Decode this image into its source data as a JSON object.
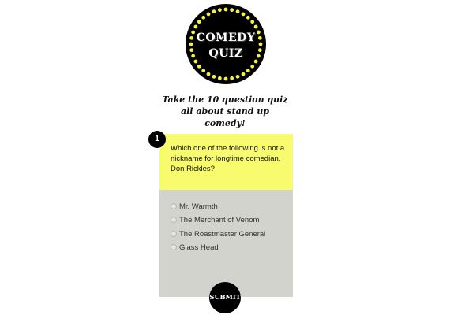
{
  "logo": {
    "line1": "COMEDY",
    "line2": "QUIZ",
    "bulb_color": "#f3f04a"
  },
  "tagline": "Take the 10 question quiz all about stand up comedy!",
  "question": {
    "number": "1",
    "text": "Which one of the following is not a nickname for longtime comedian, Don Rickles?",
    "header_color": "#f9fb6e",
    "options": [
      "Mr. Warmth",
      "The Merchant of Venom",
      "The Roastmaster General",
      "Glass Head"
    ]
  },
  "submit_label": "SUBMIT"
}
